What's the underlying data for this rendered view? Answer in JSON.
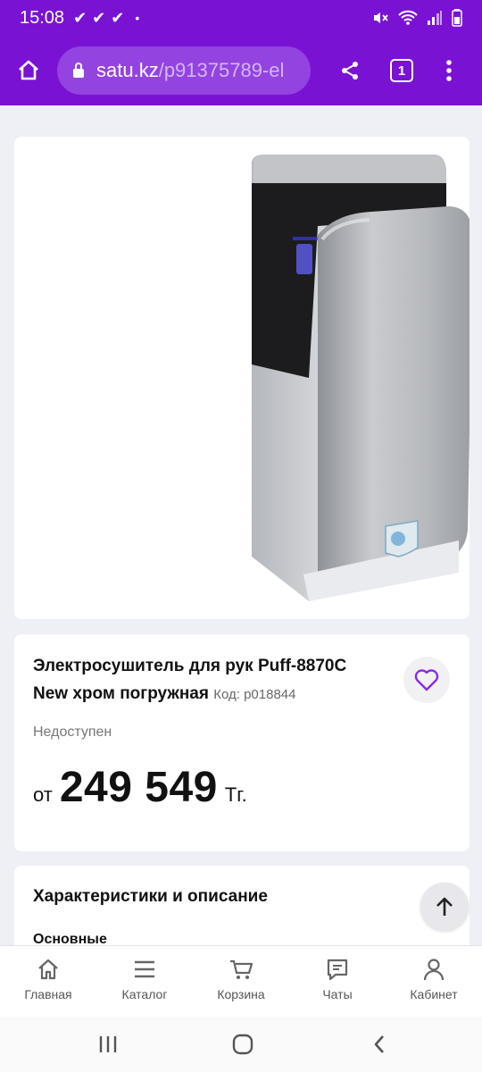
{
  "status_bar": {
    "time": "15:08",
    "checks": "✔✔✔",
    "dot": "•"
  },
  "browser": {
    "url_host": "satu.kz",
    "url_path": "/p91375789-el",
    "tab_count": "1"
  },
  "product": {
    "title": "Электросушитель для рук Puff-8870C New хром погружная",
    "code": "Код: p018844",
    "availability": "Недоступен",
    "price_prefix": "от",
    "price": "249 549",
    "currency": "Тг."
  },
  "specs": {
    "title": "Характеристики и описание",
    "subtitle": "Основные"
  },
  "bottom_nav": [
    {
      "label": "Главная",
      "icon": "home-icon"
    },
    {
      "label": "Каталог",
      "icon": "menu-icon"
    },
    {
      "label": "Корзина",
      "icon": "cart-icon"
    },
    {
      "label": "Чаты",
      "icon": "chat-icon"
    },
    {
      "label": "Кабинет",
      "icon": "user-icon"
    }
  ],
  "colors": {
    "brand": "#7a12d4",
    "accent": "#8a2be2",
    "card": "#ffffff",
    "background": "#eef0f5"
  }
}
